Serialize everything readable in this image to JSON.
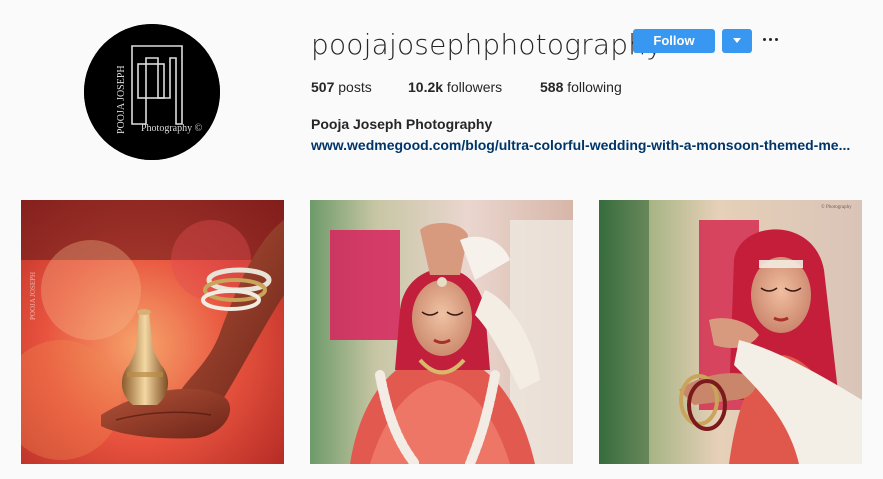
{
  "profile": {
    "username": "poojajosephphotography",
    "full_name": "Pooja Joseph Photography",
    "website": "www.wedmegood.com/blog/ultra-colorful-wedding-with-a-monsoon-themed-me...",
    "avatar": {
      "logo_text_vertical": "POOJA JOSEPH",
      "logo_text_bottom": "Photography ©"
    }
  },
  "actions": {
    "follow_label": "Follow",
    "dropdown_icon": "caret-down-icon",
    "more_icon": "ellipsis-icon"
  },
  "stats": {
    "posts_count": "507",
    "posts_label": " posts",
    "followers_count": "10.2k",
    "followers_label": " followers",
    "following_count": "588",
    "following_label": " following"
  },
  "colors": {
    "follow_button": "#3897f0",
    "link": "#003569",
    "background": "#fafafa"
  },
  "photos": [
    {
      "name": "bride-hands-with-kalash",
      "watermark": "POOJA JOSEPH"
    },
    {
      "name": "bride-sindoor-ceremony",
      "watermark": ""
    },
    {
      "name": "bride-ring-ceremony",
      "watermark": "© Photography"
    }
  ]
}
